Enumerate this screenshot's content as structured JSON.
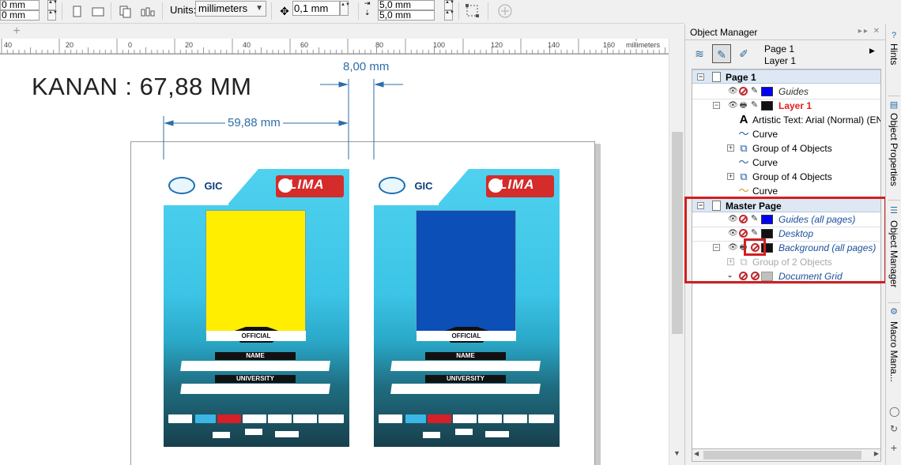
{
  "toolbar": {
    "width_value": "0 mm",
    "height_value": "0 mm",
    "units_label": "Units:",
    "units_value": "millimeters",
    "nudge_value": "0,1 mm",
    "dup_x_value": "5,0 mm",
    "dup_y_value": "5,0 mm"
  },
  "ruler": {
    "ticks": [
      "40",
      "20",
      "0",
      "20",
      "40",
      "60",
      "80",
      "100",
      "120",
      "140",
      "160"
    ],
    "unit": "millimeters"
  },
  "canvas": {
    "heading": "KANAN : 67,88 MM",
    "dim_gap": "8,00 mm",
    "dim_width": "59,88 mm"
  },
  "cards": {
    "official": "OFFICIAL",
    "name": "NAME",
    "university": "UNIVERSITY",
    "lima": "LIMA",
    "gic": "GIC",
    "left_photo_color": "#ffee00",
    "right_photo_color": "#0b4fb7"
  },
  "object_manager": {
    "title": "Object Manager",
    "page_label": "Page 1",
    "layer_label": "Layer 1",
    "tree": {
      "page1": "Page 1",
      "guides": "Guides",
      "layer1": "Layer 1",
      "artistic_text": "Artistic Text: Arial (Normal) (EN",
      "curve1": "Curve",
      "group1": "Group of 4 Objects",
      "curve2": "Curve",
      "group2": "Group of 4 Objects",
      "curve3": "Curve",
      "master_page": "Master Page",
      "guides_all": "Guides (all pages)",
      "desktop": "Desktop",
      "background_all": "Background (all pages)",
      "group_of_2": "Group of 2 Objects",
      "document_grid": "Document Grid"
    },
    "colors": {
      "guides": "#0000ff",
      "layer": "#111111",
      "desktop": "#111111",
      "background": "#111111",
      "grid": "#c0c0c0",
      "highlight": "#d11f1f"
    }
  },
  "dock": {
    "hints": "Hints",
    "object_properties": "Object Properties",
    "object_manager": "Object Manager",
    "macro_manager": "Macro Mana..."
  }
}
